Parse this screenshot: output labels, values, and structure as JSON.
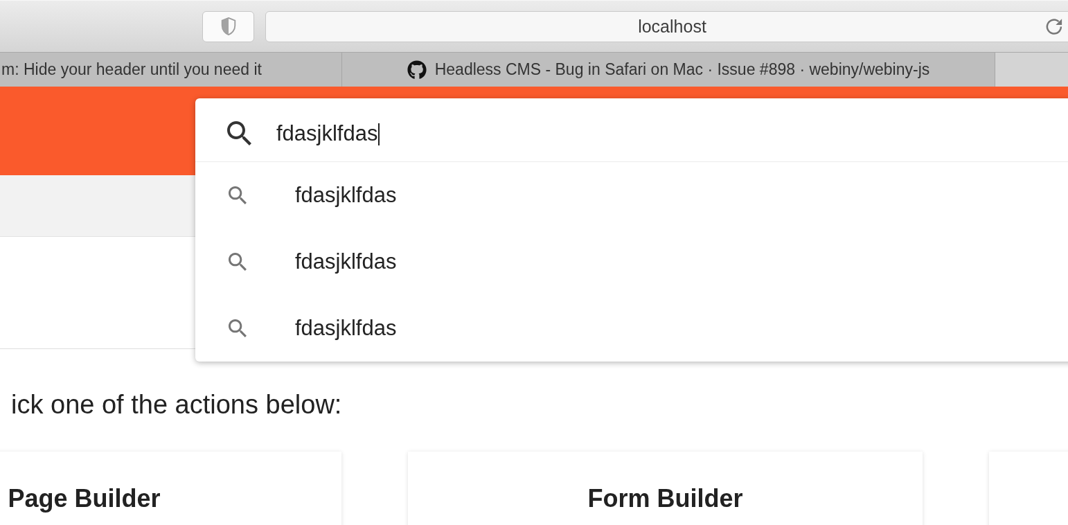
{
  "browser": {
    "address": "localhost",
    "tabs": [
      {
        "title": "m: Hide your header until you need it",
        "icon": false,
        "selected": false
      },
      {
        "title": "Headless CMS - Bug in Safari on Mac · Issue #898 · webiny/webiny-js",
        "icon": true,
        "selected": false
      },
      {
        "icon": false,
        "selected": true
      }
    ]
  },
  "search": {
    "value": "fdasjklfdas",
    "focused": true,
    "suggestions": [
      "fdasjklfdas",
      "fdasjklfdas",
      "fdasjklfdas"
    ]
  },
  "page": {
    "prompt": "ick one of the actions below:",
    "cards": [
      {
        "title": "Page Builder"
      },
      {
        "title": "Form Builder"
      }
    ]
  }
}
